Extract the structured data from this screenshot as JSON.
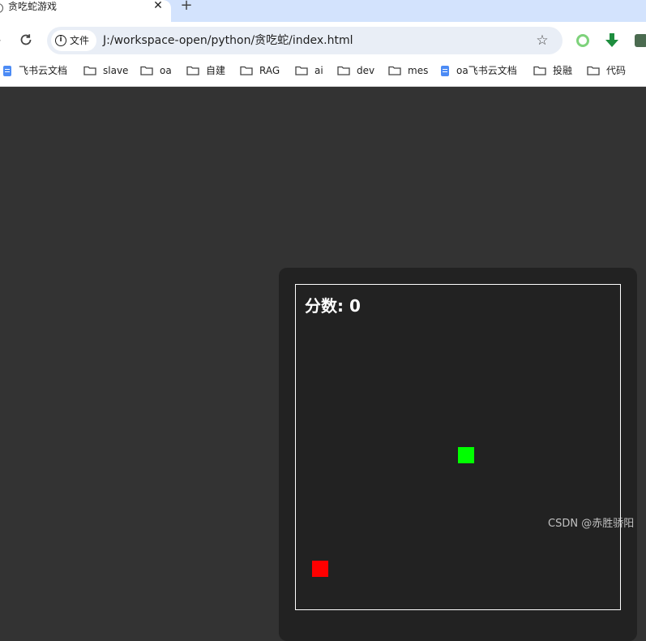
{
  "browser": {
    "tab": {
      "title": "贪吃蛇游戏",
      "close_glyph": "✕"
    },
    "new_tab_glyph": "+",
    "address": {
      "security_label": "文件",
      "url": "J:/workspace-open/python/贪吃蛇/index.html"
    },
    "icons": {
      "reload": "reload-icon",
      "bookmark_star": "star-icon",
      "info": "info-icon",
      "extension_1": "ring-extension-icon",
      "extension_2": "download-arrow-icon",
      "extension_3": "download-box-icon"
    },
    "bookmarks": [
      {
        "label": "飞书云文档",
        "icon": "doc"
      },
      {
        "label": "slave",
        "icon": "folder"
      },
      {
        "label": "oa",
        "icon": "folder"
      },
      {
        "label": "自建",
        "icon": "folder"
      },
      {
        "label": "RAG",
        "icon": "folder"
      },
      {
        "label": "ai",
        "icon": "folder"
      },
      {
        "label": "dev",
        "icon": "folder"
      },
      {
        "label": "mes",
        "icon": "folder"
      },
      {
        "label": "oa飞书云文档",
        "icon": "doc"
      },
      {
        "label": "投融",
        "icon": "folder"
      },
      {
        "label": "代码",
        "icon": "folder"
      }
    ]
  },
  "game": {
    "score_label": "分数",
    "score": "0",
    "colors": {
      "page_bg": "#333333",
      "board_bg": "#222222",
      "snake": "#00ff00",
      "food": "#ff0000",
      "border": "#ffffff"
    }
  },
  "watermark": "CSDN @赤胜骄阳"
}
